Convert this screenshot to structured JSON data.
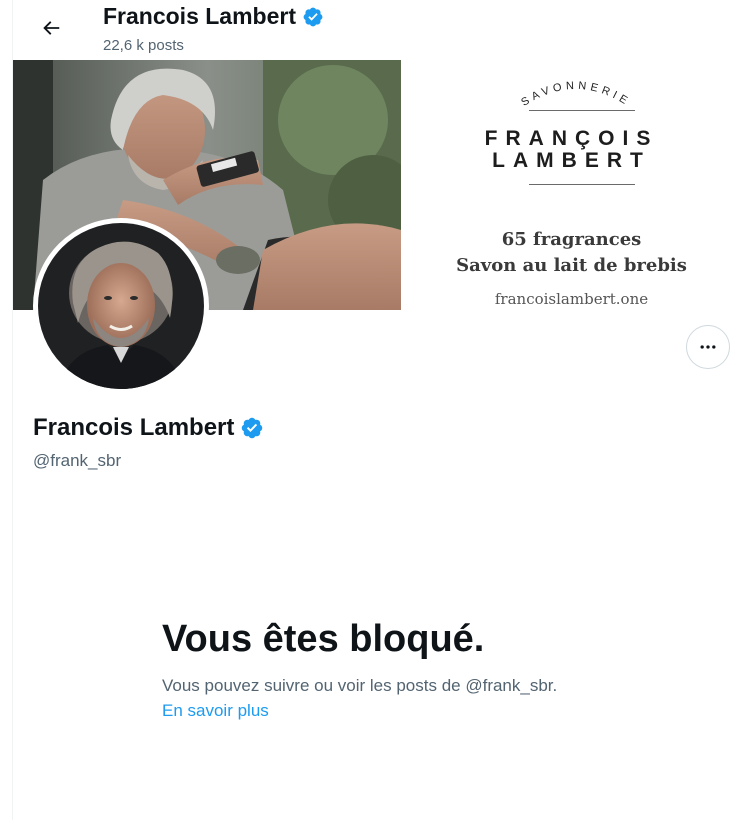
{
  "header": {
    "name": "Francois Lambert",
    "posts_count": "22,6 k posts",
    "verified": true
  },
  "banner": {
    "brand_top": "SAVONNERIE",
    "brand_line1": "FRANÇOIS",
    "brand_line2": "LAMBERT",
    "tagline1": "65 fragrances",
    "tagline2": "Savon au lait de brebis",
    "url": "francoislambert.one"
  },
  "profile": {
    "name": "Francois Lambert",
    "handle": "@frank_sbr",
    "verified": true
  },
  "blocked": {
    "title": "Vous êtes bloqué.",
    "description": "Vous pouvez suivre ou voir les posts de @frank_sbr.",
    "learn_more": "En savoir plus"
  },
  "icons": {
    "back": "arrow-left-icon",
    "verified": "verified-badge-icon",
    "more": "more-horizontal-icon"
  },
  "colors": {
    "accent": "#1d9bf0",
    "text_primary": "#0f1419",
    "text_secondary": "#536471",
    "border": "#cfd9de"
  }
}
